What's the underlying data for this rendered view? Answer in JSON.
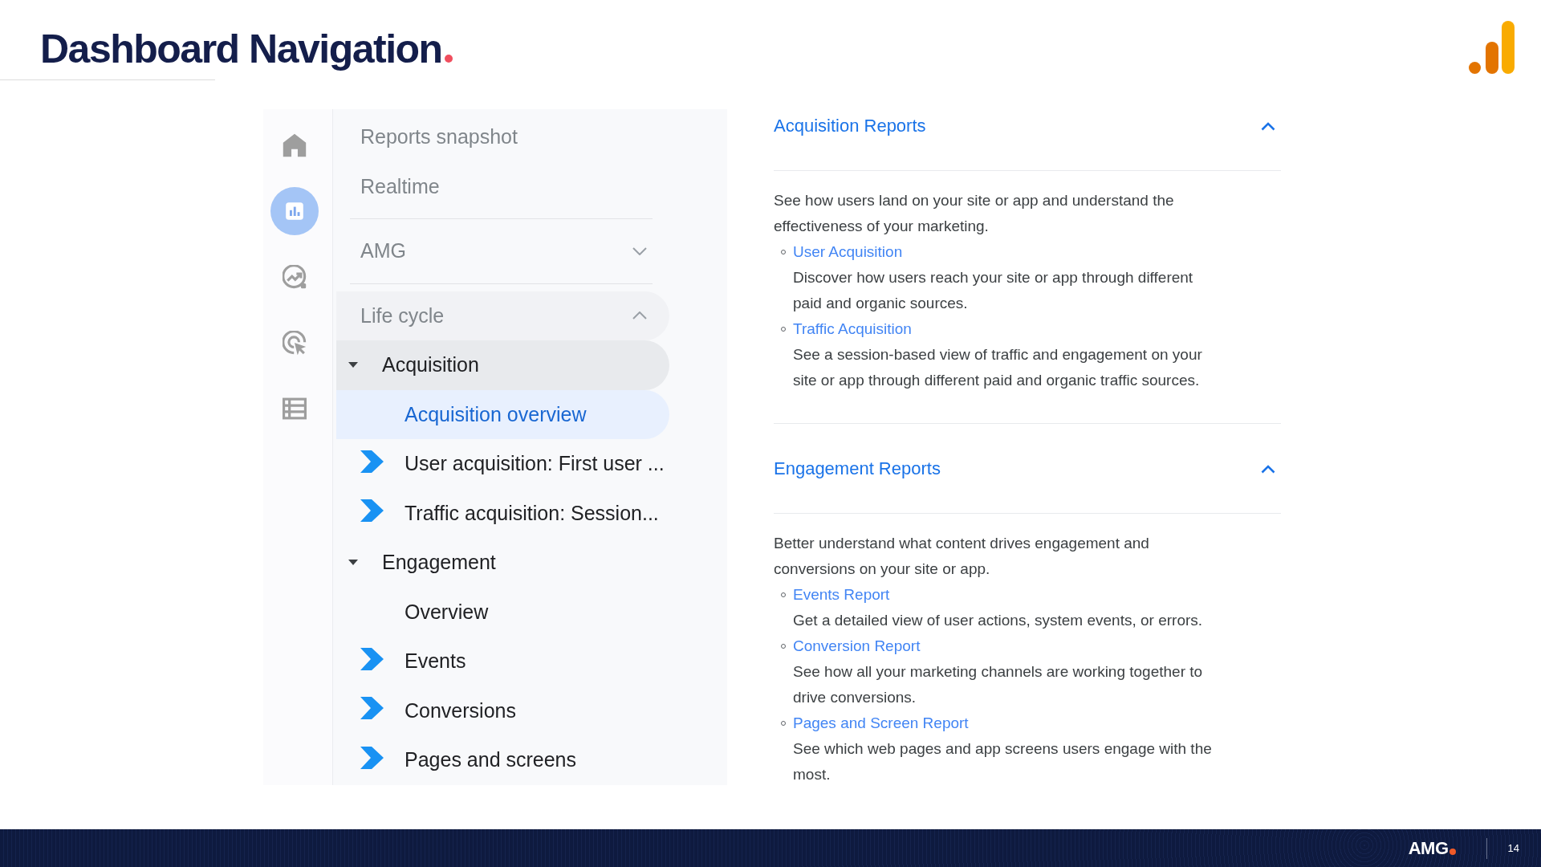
{
  "header": {
    "title": "Dashboard Navigation"
  },
  "rail": {
    "items": [
      {
        "selected": false
      },
      {
        "selected": true
      },
      {
        "selected": false
      },
      {
        "selected": false
      },
      {
        "selected": false
      }
    ]
  },
  "nav": {
    "items": [
      {
        "kind": "link",
        "label": "Reports snapshot"
      },
      {
        "kind": "link",
        "label": "Realtime"
      },
      {
        "kind": "section",
        "label": "AMG",
        "expanded": false
      },
      {
        "kind": "section",
        "label": "Life cycle",
        "expanded": true,
        "children": [
          {
            "kind": "group",
            "label": "Acquisition",
            "expanded": true,
            "active": true,
            "children": [
              {
                "label": "Acquisition overview",
                "selected": true,
                "marked": false
              },
              {
                "label": "User acquisition: First user ...",
                "selected": false,
                "marked": true
              },
              {
                "label": "Traffic acquisition: Session...",
                "selected": false,
                "marked": true
              }
            ]
          },
          {
            "kind": "group",
            "label": "Engagement",
            "expanded": true,
            "active": false,
            "children": [
              {
                "label": "Overview",
                "selected": false,
                "marked": false
              },
              {
                "label": "Events",
                "selected": false,
                "marked": true
              },
              {
                "label": "Conversions",
                "selected": false,
                "marked": true
              },
              {
                "label": "Pages and screens",
                "selected": false,
                "marked": true
              }
            ]
          }
        ]
      }
    ]
  },
  "details": {
    "sections": [
      {
        "title": "Acquisition Reports",
        "expanded": true,
        "intro": "See how users land on your site or app and understand the effectiveness of your marketing.",
        "reports": [
          {
            "name": "User Acquisition",
            "description": "Discover how users reach your site or app through different paid and organic sources."
          },
          {
            "name": "Traffic Acquisition",
            "description": "See a session-based view of traffic and engagement on your site or app through different paid and organic traffic sources."
          }
        ]
      },
      {
        "title": "Engagement Reports",
        "expanded": true,
        "intro": "Better understand what content drives engagement and conversions on your site or app.",
        "reports": [
          {
            "name": "Events Report",
            "description": "Get a detailed view of user actions, system events, or errors."
          },
          {
            "name": "Conversion Report",
            "description": "See how all your marketing channels are working together to drive conversions."
          },
          {
            "name": "Pages and Screen Report",
            "description": "See which web pages and app screens users engage with the most."
          }
        ]
      }
    ]
  },
  "footer": {
    "brand": "AMG",
    "page_number": "14"
  }
}
